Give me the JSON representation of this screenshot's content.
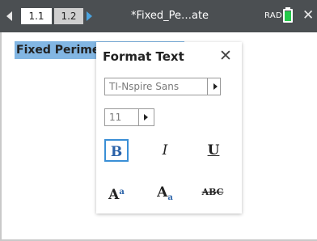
{
  "tabs": [
    {
      "label": "1.1",
      "active": true
    },
    {
      "label": "1.2",
      "active": false
    }
  ],
  "document_title": "*Fixed_Pe…ate",
  "angle_mode": "RAD",
  "close_symbol": "✕",
  "page": {
    "text_box": "Fixed Perimeter"
  },
  "format_panel": {
    "title": "Format Text",
    "close_symbol": "✕",
    "font_family": "TI-Nspire Sans",
    "font_size": "11",
    "buttons": {
      "bold": "B",
      "italic": "I",
      "underline": "U",
      "superscript_base": "A",
      "superscript_mark": "a",
      "subscript_base": "A",
      "subscript_mark": "a",
      "strikethrough": "ABC"
    },
    "selected": "bold"
  },
  "colors": {
    "top_bar": "#4b4f52",
    "selection": "#82b6e3",
    "accent": "#3a8fd6",
    "battery": "#23c94a"
  },
  "icons": [
    "nav-left-icon",
    "nav-right-icon",
    "battery-icon",
    "close-icon",
    "dropdown-arrow-icon"
  ]
}
